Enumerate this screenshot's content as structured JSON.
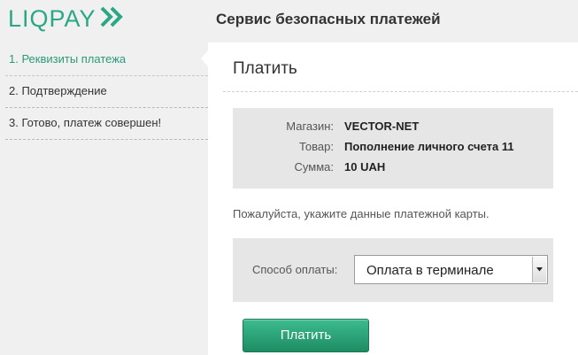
{
  "brand": {
    "name": "LIQPAY",
    "color": "#2aa784"
  },
  "header": {
    "title": "Сервис безопасных платежей"
  },
  "steps": [
    {
      "label": "1. Реквизиты платежа",
      "active": true
    },
    {
      "label": "2. Подтверждение",
      "active": false
    },
    {
      "label": "3. Готово, платеж совершен!",
      "active": false
    }
  ],
  "panel": {
    "title": "Платить"
  },
  "payment_info": {
    "shop_label": "Магазин:",
    "shop_value": "VECTOR-NET",
    "product_label": "Товар:",
    "product_value": "Пополнение личного счета 11",
    "amount_label": "Сумма:",
    "amount_value": "10 UAH"
  },
  "hint": "Пожалуйста, укажите данные платежной карты.",
  "payment_method": {
    "label": "Способ оплаты:",
    "selected": "Оплата в терминале"
  },
  "pay_button": {
    "label": "Платить",
    "color": "#1e8c63"
  }
}
